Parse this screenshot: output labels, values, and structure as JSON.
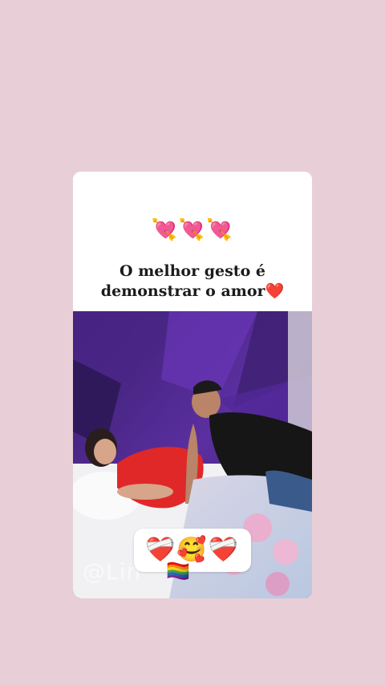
{
  "story": {
    "header_emojis": "💘💘💘",
    "headline_line1": "O melhor gesto é",
    "headline_line2": "demonstrar o amor❤️",
    "sticker_emojis": "❤️‍🩹🥰❤️‍🩹",
    "flag_emoji": "🏳️‍🌈",
    "watermark_text": "@Lin"
  },
  "colors": {
    "page_background": "#e8cfd7",
    "card_background": "#ffffff",
    "headline_text": "#1b1b1b"
  },
  "icons": {
    "header": "heart-with-arrow-icon",
    "sticker": "mending-heart-and-smiling-face-icon",
    "flag": "rainbow-flag-icon"
  }
}
